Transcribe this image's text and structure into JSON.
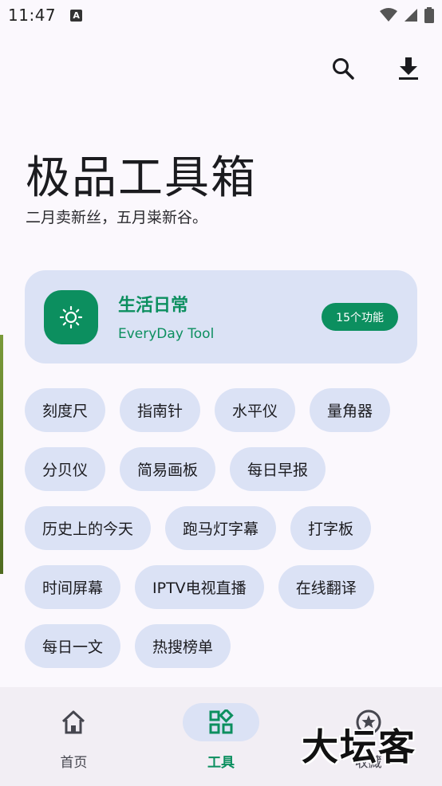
{
  "status_bar": {
    "time": "11:47",
    "notification_icon": "A"
  },
  "header": {
    "title": "极品工具箱",
    "subtitle": "二月卖新丝，五月粜新谷。"
  },
  "toolbar": {
    "search_icon": "search-icon",
    "download_icon": "download-icon"
  },
  "category": {
    "title": "生活日常",
    "subtitle": "EveryDay Tool",
    "count": "15个功能",
    "icon": "brightness-icon",
    "accent": "#0c8f5f",
    "card_color": "#dbe2f5"
  },
  "tools": [
    "刻度尺",
    "指南针",
    "水平仪",
    "量角器",
    "分贝仪",
    "简易画板",
    "每日早报",
    "历史上的今天",
    "跑马灯字幕",
    "打字板",
    "时间屏幕",
    "IPTV电视直播",
    "在线翻译",
    "每日一文",
    "热搜榜单"
  ],
  "nav": {
    "items": [
      {
        "label": "首页",
        "icon": "home-icon"
      },
      {
        "label": "工具",
        "icon": "tools-icon",
        "active": true
      },
      {
        "label": "收藏",
        "icon": "star-icon"
      }
    ]
  },
  "watermark": "大坛客"
}
